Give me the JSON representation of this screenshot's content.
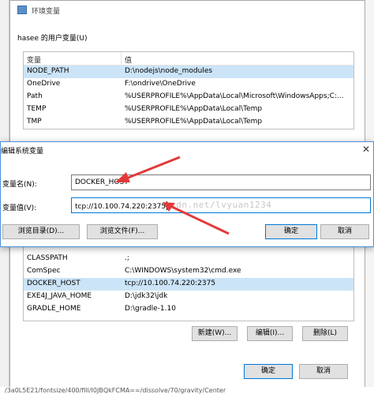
{
  "window": {
    "title": "环境变量",
    "user_group_label": "hasee 的用户变量(U)",
    "columns": [
      "变量",
      "值"
    ],
    "user_vars": [
      {
        "name": "NODE_PATH",
        "value": "D:\\nodejs\\node_modules"
      },
      {
        "name": "OneDrive",
        "value": "F:\\ondrive\\OneDrive"
      },
      {
        "name": "Path",
        "value": "%USERPROFILE%\\AppData\\Local\\Microsoft\\WindowsApps;C:..."
      },
      {
        "name": "TEMP",
        "value": "%USERPROFILE%\\AppData\\Local\\Temp"
      },
      {
        "name": "TMP",
        "value": "%USERPROFILE%\\AppData\\Local\\Temp"
      }
    ],
    "sys_vars": [
      {
        "name": "CLASSPATH",
        "value": ".;"
      },
      {
        "name": "ComSpec",
        "value": "C:\\WINDOWS\\system32\\cmd.exe"
      },
      {
        "name": "DOCKER_HOST",
        "value": "tcp://10.100.74.220:2375"
      },
      {
        "name": "EXE4J_JAVA_HOME",
        "value": "D:\\jdk32\\jdk"
      },
      {
        "name": "GRADLE_HOME",
        "value": "D:\\gradle-1.10"
      }
    ],
    "buttons": {
      "new": "新建(W)...",
      "edit": "编辑(I)...",
      "delete": "删除(L)",
      "ok": "确定",
      "cancel": "取消"
    }
  },
  "dialog": {
    "title": "编辑系统变量",
    "close_symbol": "✕",
    "name_label": "变量名(N):",
    "name_value": "DOCKER_HOST",
    "value_label": "变量值(V):",
    "value_value": "tcp://10.100.74.220:2375",
    "watermark": "csdn.net/lvyuan1234",
    "buttons": {
      "browse_dir": "浏览目录(D)...",
      "browse_file": "浏览文件(F)...",
      "ok": "确定",
      "cancel": "取消"
    }
  },
  "footer_url": "/3a0L5E21/fontsize/400/fill/I0JBQkFCMA==/dissolve/70/gravity/Center",
  "colors": {
    "accent": "#0078d7",
    "arrow": "#e23a3a",
    "selection": "#cce4f7"
  }
}
